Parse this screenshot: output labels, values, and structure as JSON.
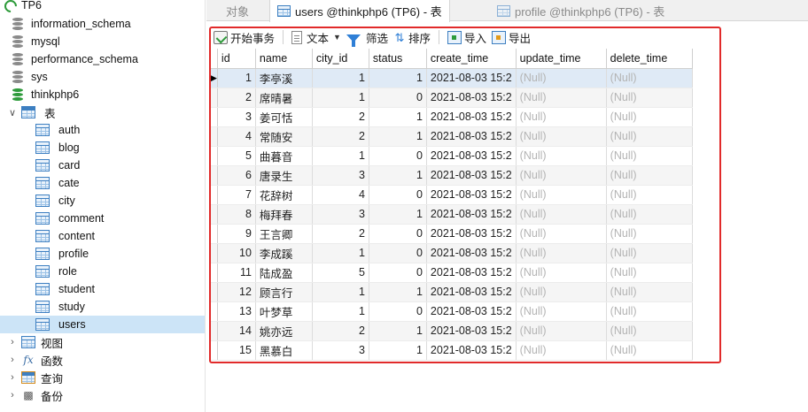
{
  "navigator": {
    "connection": "TP6",
    "databases": [
      "information_schema",
      "mysql",
      "performance_schema",
      "sys"
    ],
    "active_database": "thinkphp6",
    "tables_group": "表",
    "tables": [
      "auth",
      "blog",
      "card",
      "cate",
      "city",
      "comment",
      "content",
      "profile",
      "role",
      "student",
      "study",
      "users"
    ],
    "selected_table": "users",
    "other_groups": [
      "视图",
      "函数",
      "查询",
      "备份"
    ]
  },
  "tabs": {
    "objects": "对象",
    "active": "users @thinkphp6 (TP6) - 表",
    "inactive": "profile @thinkphp6 (TP6) - 表"
  },
  "toolbar": {
    "begin_transaction": "开始事务",
    "text": "文本",
    "filter": "筛选",
    "sort": "排序",
    "import": "导入",
    "export": "导出"
  },
  "grid": {
    "columns": [
      "id",
      "name",
      "city_id",
      "status",
      "create_time",
      "update_time",
      "delete_time"
    ],
    "null_text": "(Null)",
    "current_row_marker": "▶",
    "rows": [
      [
        "1",
        "李亭溪",
        "1",
        "1",
        "2021-08-03 15:2"
      ],
      [
        "2",
        "席晴暑",
        "1",
        "0",
        "2021-08-03 15:2"
      ],
      [
        "3",
        "姜可恬",
        "2",
        "1",
        "2021-08-03 15:2"
      ],
      [
        "4",
        "常随安",
        "2",
        "1",
        "2021-08-03 15:2"
      ],
      [
        "5",
        "曲暮音",
        "1",
        "0",
        "2021-08-03 15:2"
      ],
      [
        "6",
        "唐录生",
        "3",
        "1",
        "2021-08-03 15:2"
      ],
      [
        "7",
        "花辞树",
        "4",
        "0",
        "2021-08-03 15:2"
      ],
      [
        "8",
        "梅拜春",
        "3",
        "1",
        "2021-08-03 15:2"
      ],
      [
        "9",
        "王言卿",
        "2",
        "0",
        "2021-08-03 15:2"
      ],
      [
        "10",
        "李成蹊",
        "1",
        "0",
        "2021-08-03 15:2"
      ],
      [
        "11",
        "陆成盈",
        "5",
        "0",
        "2021-08-03 15:2"
      ],
      [
        "12",
        "顾言行",
        "1",
        "1",
        "2021-08-03 15:2"
      ],
      [
        "13",
        "叶梦草",
        "1",
        "0",
        "2021-08-03 15:2"
      ],
      [
        "14",
        "姚亦远",
        "2",
        "1",
        "2021-08-03 15:2"
      ],
      [
        "15",
        "黑慕白",
        "3",
        "1",
        "2021-08-03 15:2"
      ]
    ]
  },
  "colors": {
    "highlight_frame": "#e12a2a",
    "selection": "#cce4f7",
    "null_text": "#b4b4b4"
  }
}
